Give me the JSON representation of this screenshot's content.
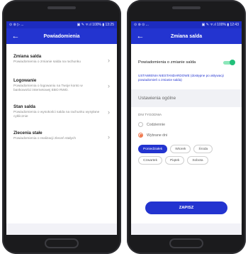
{
  "left": {
    "status": {
      "left_icons": "⊙ ⊚ ▷ ...",
      "right_text": "▣ ✎ ᯤ.ıl 100% ▮ 13:25"
    },
    "title": "Powiadomienia",
    "items": [
      {
        "title": "Zmiana salda",
        "subtitle": "Powiadomienia o zmianie salda na rachunku"
      },
      {
        "title": "Logowanie",
        "subtitle": "Powiadomienia o logowaniu na Twoje konto w bankowości internetowej EBO RWD."
      },
      {
        "title": "Stan salda",
        "subtitle": "Powiadomienia o wysokości salda na rachunku wysyłane cyklicznie"
      },
      {
        "title": "Zlecenia stałe",
        "subtitle": "Powiadomienia o realizacji zleceń stałych"
      }
    ]
  },
  "right": {
    "status": {
      "left_icons": "⊙ ⊚ ⊙ ...",
      "right_text": "▣ ✎ ᯤ.ıl 100% ▮ 12:43"
    },
    "title": "Zmiana salda",
    "toggle_label": "Powiadomienia o zmianie salda",
    "toggle_on": true,
    "advanced_text": "USTAWIENIA NIESTANDARDOWE (dostępne po aktywacji powiadomień o zmianie salda)",
    "section_title": "Ustawienia ogólne",
    "days_title": "DNI TYGODNIA",
    "radio_options": [
      "Codziennie",
      "Wybrane dni"
    ],
    "radio_selected": "Wybrane dni",
    "days": [
      "Poniedziałek",
      "Wtorek",
      "Środa",
      "Czwartek",
      "Piątek",
      "Sobota"
    ],
    "active_day": "Poniedziałek",
    "save_label": "ZAPISZ"
  },
  "colors": {
    "brand": "#2334d0",
    "statusbar": "#1d2cc0",
    "toggle_on": "#22c07a",
    "radio_accent": "#f07a50"
  }
}
